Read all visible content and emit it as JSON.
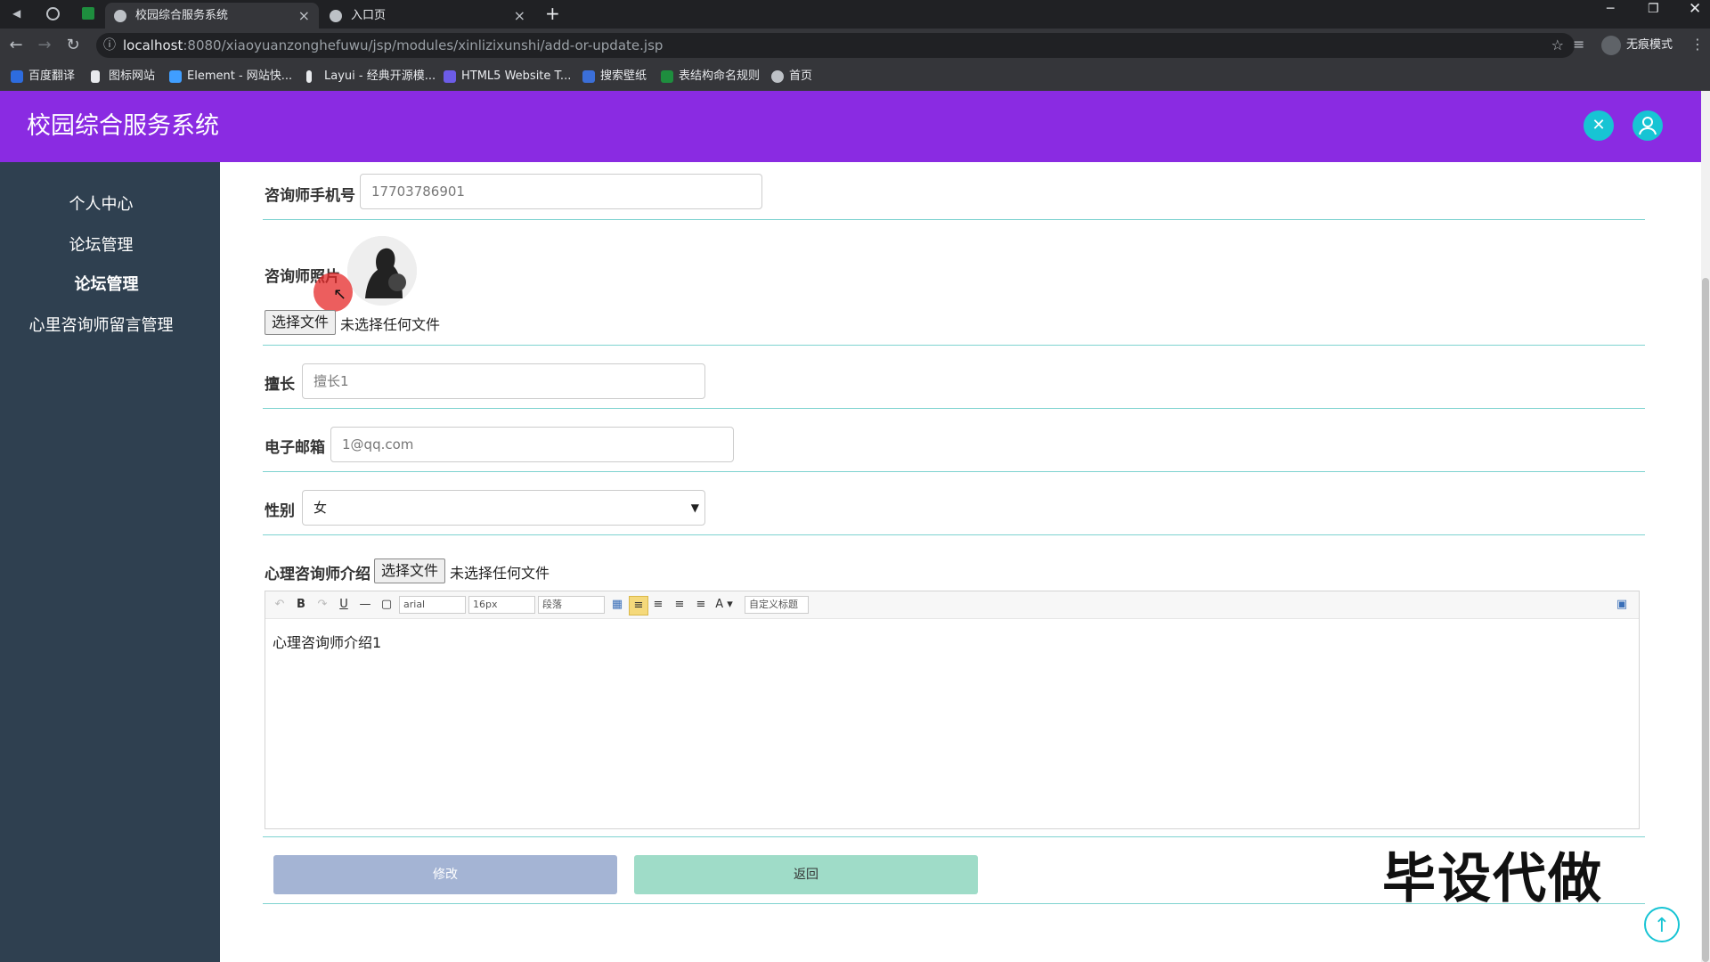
{
  "browser": {
    "tabs": [
      {
        "title": "校园综合服务系统",
        "active": true
      },
      {
        "title": "入口页",
        "active": false
      }
    ],
    "url_host": "localhost",
    "url_path": ":8080/xiaoyuanzonghefuwu/jsp/modules/xinlizixunshi/add-or-update.jsp",
    "profile_label": "无痕模式",
    "bookmarks": [
      "百度翻译",
      "图标网站",
      "Element - 网站快...",
      "Layui - 经典开源模...",
      "HTML5 Website T...",
      "搜索壁纸",
      "表结构命名规则",
      "首页"
    ]
  },
  "app": {
    "title": "校园综合服务系统",
    "colors": {
      "header": "#8a2be2",
      "sidebar": "#2f4050",
      "accent": "#17c4d4",
      "divider": "#7ed3d0"
    }
  },
  "sidebar": {
    "items": [
      "个人中心",
      "论坛管理",
      "论坛管理",
      "心里咨询师留言管理"
    ]
  },
  "form": {
    "phone": {
      "label": "咨询师手机号",
      "value": "17703786901"
    },
    "photo": {
      "label": "咨询师照片",
      "file_button": "选择文件",
      "file_text": "未选择任何文件"
    },
    "specialty": {
      "label": "擅长",
      "value": "擅长1"
    },
    "email": {
      "label": "电子邮箱",
      "value": "1@qq.com"
    },
    "gender": {
      "label": "性别",
      "value": "女"
    },
    "intro": {
      "label": "心理咨询师介绍",
      "file_button": "选择文件",
      "file_text": "未选择任何文件",
      "content": "心理咨询师介绍1"
    },
    "editor_toolbar": {
      "font": "arial",
      "size": "16px",
      "paragraph": "段落",
      "custom_title": "自定义标题"
    }
  },
  "actions": {
    "submit": "修改",
    "back": "返回"
  },
  "watermark": "毕设代做"
}
